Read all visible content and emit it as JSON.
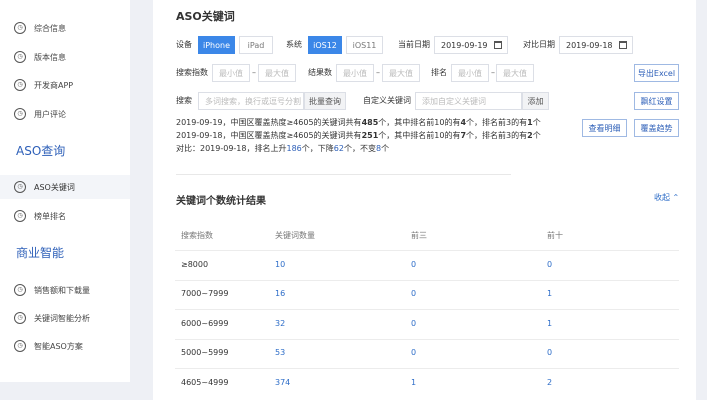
{
  "sidebar": {
    "top_items": [
      {
        "label": "综合信息",
        "icon": "circle-icon"
      },
      {
        "label": "版本信息",
        "icon": "clock-icon"
      },
      {
        "label": "开发商APP",
        "icon": "circle-icon"
      },
      {
        "label": "用户评论",
        "icon": "circle-icon"
      }
    ],
    "section1": "ASO查询",
    "section1_items": [
      {
        "label": "ASO关键词",
        "icon": "circle-icon",
        "active": true
      },
      {
        "label": "榜单排名",
        "icon": "circle-icon"
      }
    ],
    "section2": "商业智能",
    "section2_items": [
      {
        "label": "销售额和下载量",
        "icon": "circle-icon"
      },
      {
        "label": "关键词智能分析",
        "icon": "circle-icon"
      },
      {
        "label": "智能ASO方案",
        "icon": "circle-icon"
      }
    ]
  },
  "filters": {
    "title": "ASO关键词",
    "device_label": "设备",
    "device_options": [
      "iPhone",
      "iPad"
    ],
    "system_label": "系统",
    "system_options": [
      "iOS12",
      "iOS11"
    ],
    "current_date_label": "当前日期",
    "current_date": "2019-09-19",
    "compare_date_label": "对比日期",
    "compare_date": "2019-09-18",
    "index_label": "搜索指数",
    "results_label": "结果数",
    "rank_label": "排名",
    "min_placeholder": "最小值",
    "max_placeholder": "最大值",
    "dash": "–",
    "search_label": "搜索",
    "search_placeholder": "多词搜索，换行或逗号分割",
    "batch_query": "批量查询",
    "custom_label": "自定义关键词",
    "custom_placeholder": "添加自定义关键词",
    "add_button": "添加",
    "export_button": "导出Excel",
    "keyword_settings_button": "飘红设置",
    "view_detail_button": "查看明细",
    "coverage_trend_button": "覆盖趋势"
  },
  "summary": {
    "line1": {
      "pre": "2019-09-19，中国区覆盖热度≥4605的关键词共有",
      "total": "485",
      "mid1": "个，其中排名前10的有",
      "top10": "4",
      "mid2": "个，排名前3的有",
      "top3": "1",
      "post": "个"
    },
    "line2": {
      "pre": "2019-09-18，中国区覆盖热度≥4605的关键词共有",
      "total": "251",
      "mid1": "个，其中排名前10的有",
      "top10": "7",
      "mid2": "个，排名前3的有",
      "top3": "2",
      "post": "个"
    },
    "line3": {
      "pre": "对比：2019-09-18，排名上升",
      "up": "186",
      "mid1": "个，下降",
      "down": "62",
      "mid2": "个，不变",
      "same": "8",
      "post": "个"
    }
  },
  "stats": {
    "title": "关键词个数统计结果",
    "collapse": "收起",
    "headers": [
      "搜索指数",
      "关键词数量",
      "前三",
      "前十"
    ],
    "rows": [
      {
        "range": "≥8000",
        "count": "10",
        "top3": "0",
        "top10": "0"
      },
      {
        "range": "7000~7999",
        "count": "16",
        "top3": "0",
        "top10": "1"
      },
      {
        "range": "6000~6999",
        "count": "32",
        "top3": "0",
        "top10": "1"
      },
      {
        "range": "5000~5999",
        "count": "53",
        "top3": "0",
        "top10": "0"
      },
      {
        "range": "4605~4999",
        "count": "374",
        "top3": "1",
        "top10": "2"
      }
    ]
  },
  "colors": {
    "primary": "#3b87e8",
    "link": "#2d6dc8",
    "section": "#2d5fb8"
  }
}
